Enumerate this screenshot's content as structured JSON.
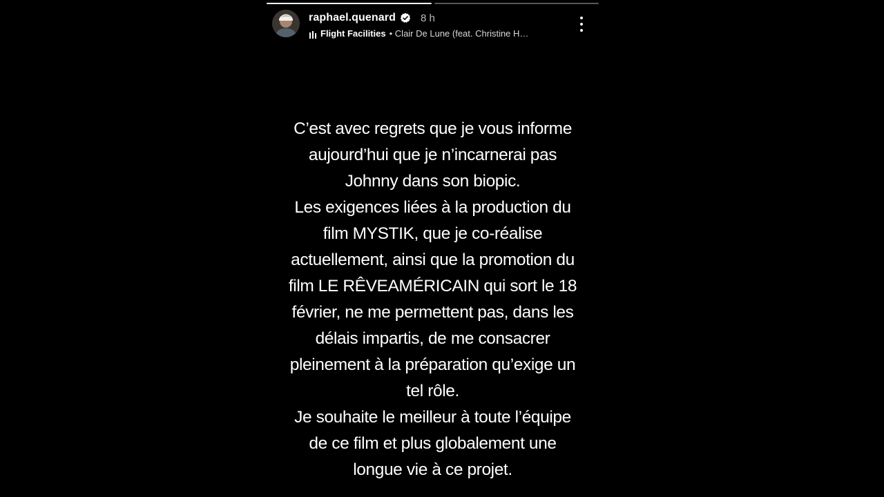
{
  "story": {
    "username": "raphael.quenard",
    "time": "8 h",
    "music": {
      "artist": "Flight Facilities",
      "track": "• Clair De Lune (feat. Christine H…"
    },
    "progress": [
      1.0,
      0.0
    ],
    "message_lines": [
      "C’est avec regrets que je vous informe",
      "aujourd’hui que je n’incarnerai pas",
      "Johnny dans son biopic.",
      "Les exigences liées à la production du",
      "film MYSTIK, que je co-réalise",
      "actuellement, ainsi que la promotion du",
      "film LE RÊVEAMÉRICAIN qui sort le 18",
      "février, ne me permettent pas, dans les",
      "délais impartis, de me consacrer",
      "pleinement à la préparation qu’exige un",
      "tel rôle.",
      "Je souhaite le meilleur à toute l’équipe",
      "de ce film et plus globalement une",
      "longue vie à ce projet."
    ]
  },
  "icons": {
    "verified": "verified-badge-icon",
    "music": "equalizer-icon",
    "more": "more-options-icon"
  },
  "colors": {
    "background": "#000000",
    "text": "#ffffff",
    "verified": "#3897f0"
  }
}
